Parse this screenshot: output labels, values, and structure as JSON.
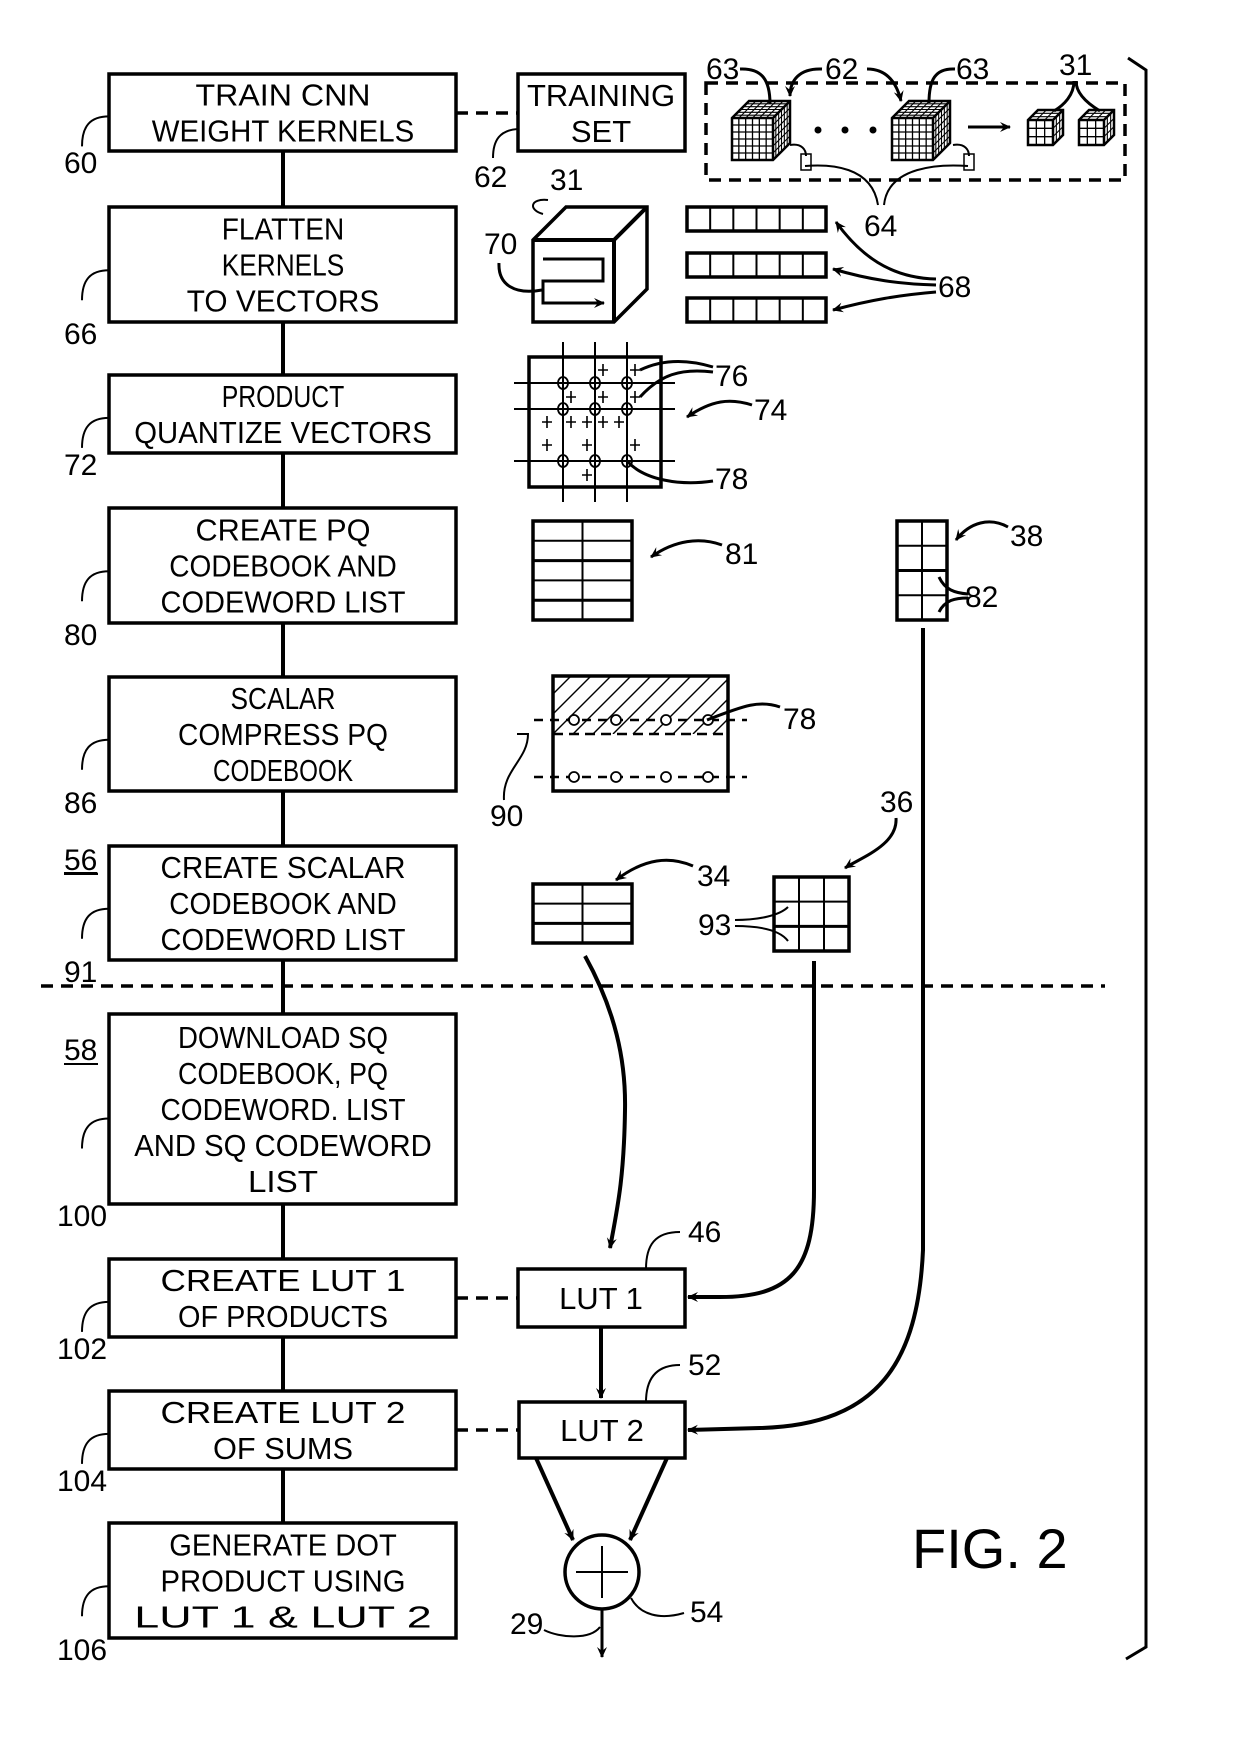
{
  "figure_label": "FIG. 2",
  "section_labels": {
    "offline": "56",
    "online": "58"
  },
  "steps": [
    {
      "ref": "60",
      "lines": [
        "TRAIN  CNN",
        "WEIGHT  KERNELS"
      ]
    },
    {
      "ref": "66",
      "lines": [
        "FLATTEN",
        "KERNELS",
        "TO  VECTORS"
      ]
    },
    {
      "ref": "72",
      "lines": [
        "PRODUCT",
        "QUANTIZE  VECTORS"
      ]
    },
    {
      "ref": "80",
      "lines": [
        "CREATE  PQ",
        "CODEBOOK  AND",
        "CODEWORD  LIST"
      ]
    },
    {
      "ref": "86",
      "lines": [
        "SCALAR",
        "COMPRESS  PQ",
        "CODEBOOK"
      ]
    },
    {
      "ref": "91",
      "lines": [
        "CREATE  SCALAR",
        "CODEBOOK  AND",
        "CODEWORD  LIST"
      ]
    },
    {
      "ref": "100",
      "lines": [
        "DOWNLOAD  SQ",
        "CODEBOOK, PQ",
        "CODEWORD. LIST",
        "AND  SQ  CODEWORD",
        "LIST"
      ]
    },
    {
      "ref": "102",
      "lines": [
        "CREATE  LUT  1",
        "OF  PRODUCTS"
      ]
    },
    {
      "ref": "104",
      "lines": [
        "CREATE  LUT  2",
        "OF  SUMS"
      ]
    },
    {
      "ref": "106",
      "lines": [
        "GENERATE  DOT",
        "PRODUCT  USING",
        "LUT  1  &  LUT  2"
      ]
    }
  ],
  "training_set": {
    "ref": "62",
    "lines": [
      "TRAINING",
      "SET"
    ]
  },
  "lut1": {
    "ref": "46",
    "label": "LUT  1"
  },
  "lut2": {
    "ref": "52",
    "label": "LUT  2"
  },
  "adder": {
    "ref": "54",
    "output_ref": "29"
  },
  "reference_numerals": {
    "kernel_cube": "63",
    "kernel_cube_2": "63",
    "training_examples": "62",
    "small_kernels": "31",
    "weights": "64",
    "flatten_cube": "31",
    "flatten_path": "70",
    "vectors": "68",
    "centroids": "76",
    "pq_space": "74",
    "pq_centroid": "78",
    "pq_codebook": "81",
    "pq_codeword_list": "38",
    "codewords": "82",
    "scalar_centroid": "78",
    "scalar_levels": "90",
    "sq_codebook": "34",
    "sq_codeword_list": "36",
    "sq_codewords": "93"
  }
}
